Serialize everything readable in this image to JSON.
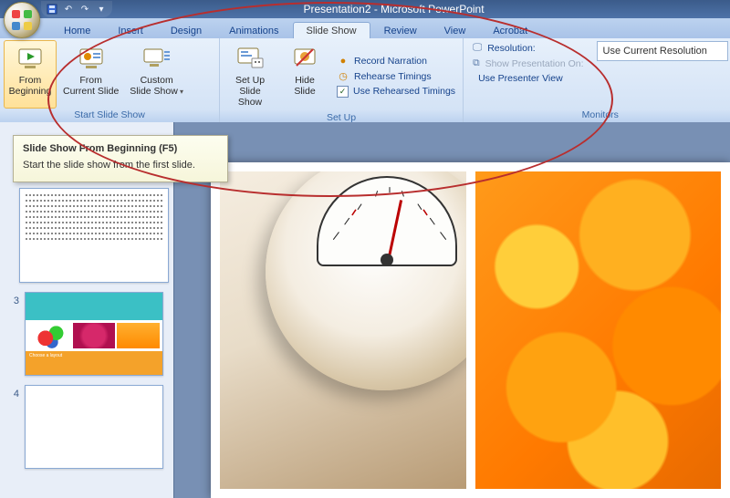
{
  "title": "Presentation2 - Microsoft PowerPoint",
  "qat": {
    "save": "save-icon",
    "undo": "undo-icon",
    "redo": "redo-icon"
  },
  "tabs": [
    {
      "label": "Home"
    },
    {
      "label": "Insert"
    },
    {
      "label": "Design"
    },
    {
      "label": "Animations"
    },
    {
      "label": "Slide Show",
      "active": true
    },
    {
      "label": "Review"
    },
    {
      "label": "View"
    },
    {
      "label": "Acrobat"
    }
  ],
  "ribbon": {
    "start": {
      "label": "Start Slide Show",
      "from_beginning": "From\nBeginning",
      "from_current": "From\nCurrent Slide",
      "custom": "Custom\nSlide Show"
    },
    "setup": {
      "label": "Set Up",
      "setup_btn": "Set Up\nSlide Show",
      "hide_btn": "Hide\nSlide",
      "record": "Record Narration",
      "rehearse": "Rehearse Timings",
      "use_rehearsed": "Use Rehearsed Timings",
      "use_rehearsed_checked": "✓"
    },
    "monitors": {
      "label": "Monitors",
      "resolution": "Resolution:",
      "resolution_value": "Use Current Resolution",
      "show_on": "Show Presentation On:",
      "presenter": "Use Presenter View"
    }
  },
  "tooltip": {
    "title": "Slide Show From Beginning (F5)",
    "body": "Start the slide show from the first slide."
  },
  "thumbs": {
    "n3": "3",
    "n4": "4",
    "layout_caption": "Choose a layout"
  }
}
